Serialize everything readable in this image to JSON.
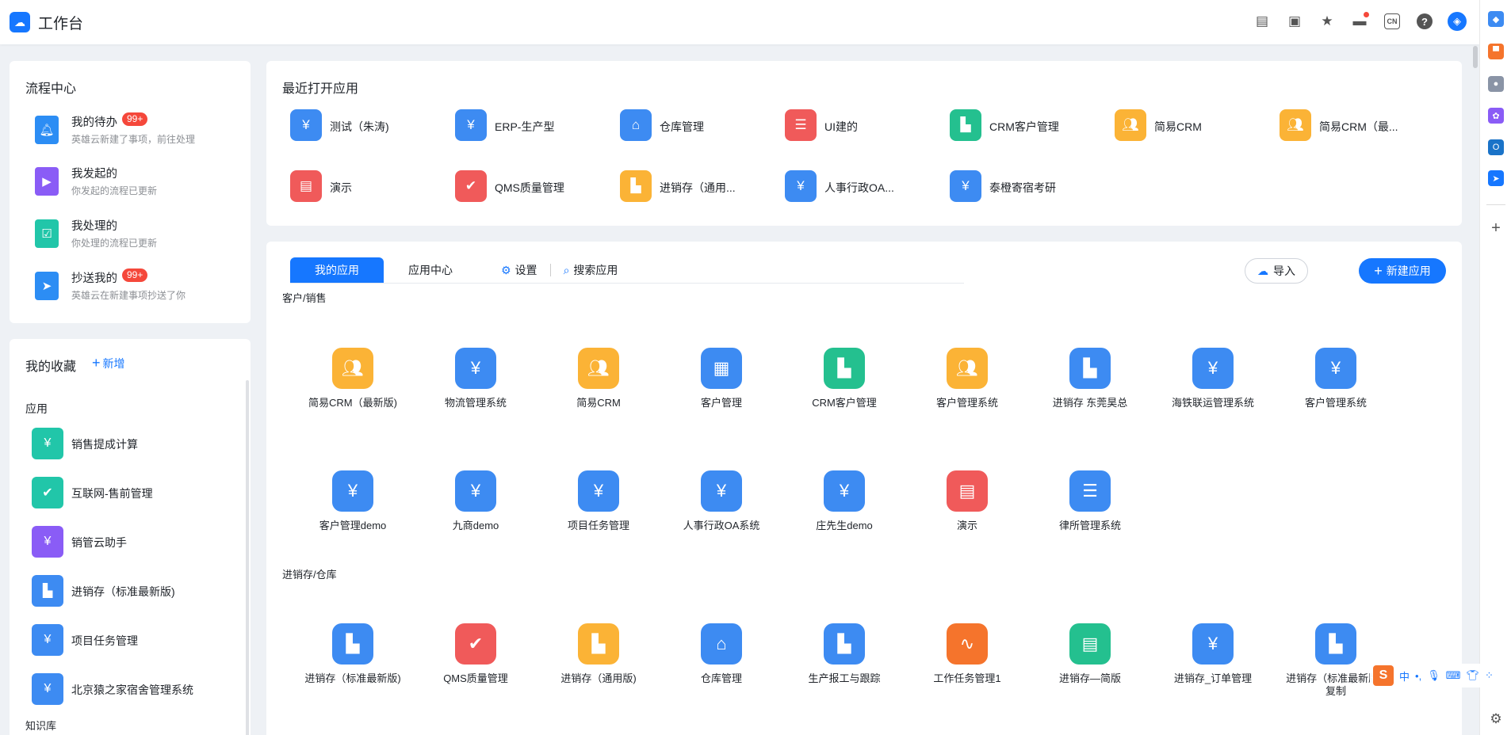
{
  "header": {
    "title": "工作台",
    "cn_label": "CN",
    "help_label": "?"
  },
  "flow_center": {
    "title": "流程中心",
    "items": [
      {
        "name": "我的待办",
        "desc": "英雄云新建了事项，前往处理",
        "badge": "99+",
        "icon": "bell-icon"
      },
      {
        "name": "我发起的",
        "desc": "你发起的流程已更新",
        "badge": "",
        "icon": "play-icon"
      },
      {
        "name": "我处理的",
        "desc": "你处理的流程已更新",
        "badge": "",
        "icon": "check-doc-icon"
      },
      {
        "name": "抄送我的",
        "desc": "英雄云在新建事项抄送了你",
        "badge": "99+",
        "icon": "send-icon"
      }
    ]
  },
  "favorites": {
    "title": "我的收藏",
    "add_label": "新增",
    "section_apps": "应用",
    "section_kb": "知识库",
    "items": [
      {
        "name": "销售提成计算",
        "icon": "doc-yen-icon"
      },
      {
        "name": "互联网-售前管理",
        "icon": "puzzle-check-icon"
      },
      {
        "name": "销管云助手",
        "icon": "hand-yen-icon"
      },
      {
        "name": "进销存（标准最新版)",
        "icon": "building-icon"
      },
      {
        "name": "项目任务管理",
        "icon": "pie-yen-icon"
      },
      {
        "name": "北京猿之家宿舍管理系统",
        "icon": "pie-yen-icon"
      }
    ]
  },
  "recent": {
    "title": "最近打开应用",
    "items": [
      {
        "name": "测试（朱涛)",
        "icon": "pie-yen-icon",
        "color": "blue"
      },
      {
        "name": "ERP-生产型",
        "icon": "pie-yen-icon",
        "color": "blue"
      },
      {
        "name": "仓库管理",
        "icon": "warehouse-icon",
        "color": "blue"
      },
      {
        "name": "UI建的",
        "icon": "list-icon",
        "color": "red"
      },
      {
        "name": "CRM客户管理",
        "icon": "building-icon",
        "color": "green"
      },
      {
        "name": "简易CRM",
        "icon": "people-icon",
        "color": "orange"
      },
      {
        "name": "简易CRM（最...",
        "icon": "people-icon",
        "color": "orange"
      },
      {
        "name": "演示",
        "icon": "doc-icon",
        "color": "red"
      },
      {
        "name": "QMS质量管理",
        "icon": "puzzle-check-icon",
        "color": "red"
      },
      {
        "name": "进销存（通用...",
        "icon": "building-icon",
        "color": "orange"
      },
      {
        "name": "人事行政OA...",
        "icon": "pie-yen-icon",
        "color": "blue"
      },
      {
        "name": "泰橙寄宿考研",
        "icon": "pie-yen-icon",
        "color": "blue"
      }
    ]
  },
  "apps": {
    "tabs": [
      "我的应用",
      "应用中心"
    ],
    "settings_label": "设置",
    "search_placeholder": "搜索应用",
    "import_label": "导入",
    "new_label": "新建应用",
    "categories": [
      {
        "label": "客户/销售",
        "apps": [
          {
            "name": "简易CRM（最新版)",
            "icon": "people-icon",
            "color": "orange"
          },
          {
            "name": "物流管理系统",
            "icon": "pie-yen-icon",
            "color": "blue"
          },
          {
            "name": "简易CRM",
            "icon": "people-icon",
            "color": "orange"
          },
          {
            "name": "客户管理",
            "icon": "office-building-icon",
            "color": "blue"
          },
          {
            "name": "CRM客户管理",
            "icon": "building-icon",
            "color": "green"
          },
          {
            "name": "客户管理系统",
            "icon": "people-icon",
            "color": "orange"
          },
          {
            "name": "进销存 东莞昊总",
            "icon": "building-icon",
            "color": "blue"
          },
          {
            "name": "海铁联运管理系统",
            "icon": "pie-yen-icon",
            "color": "blue"
          },
          {
            "name": "客户管理系统",
            "icon": "pie-yen-icon",
            "color": "blue"
          },
          {
            "name": "客户管理demo",
            "icon": "pie-yen-icon",
            "color": "blue"
          },
          {
            "name": "九商demo",
            "icon": "pie-yen-icon",
            "color": "blue"
          },
          {
            "name": "项目任务管理",
            "icon": "pie-yen-icon",
            "color": "blue"
          },
          {
            "name": "人事行政OA系统",
            "icon": "pie-yen-icon",
            "color": "blue"
          },
          {
            "name": "庄先生demo",
            "icon": "pie-yen-icon",
            "color": "blue"
          },
          {
            "name": "演示",
            "icon": "doc-icon",
            "color": "red"
          },
          {
            "name": "律所管理系统",
            "icon": "list-icon",
            "color": "blue"
          }
        ]
      },
      {
        "label": "进销存/仓库",
        "apps": [
          {
            "name": "进销存（标准最新版)",
            "icon": "building-icon",
            "color": "blue"
          },
          {
            "name": "QMS质量管理",
            "icon": "puzzle-check-icon",
            "color": "red"
          },
          {
            "name": "进销存（通用版)",
            "icon": "building-icon",
            "color": "orange"
          },
          {
            "name": "仓库管理",
            "icon": "warehouse-icon",
            "color": "blue"
          },
          {
            "name": "生产报工与跟踪",
            "icon": "building-icon",
            "color": "blue"
          },
          {
            "name": "工作任务管理1",
            "icon": "chart-doc-icon",
            "color": "deeporange"
          },
          {
            "name": "进销存—简版",
            "icon": "doc-icon",
            "color": "green"
          },
          {
            "name": "进销存_订单管理",
            "icon": "pie-yen-icon",
            "color": "blue"
          },
          {
            "name": "进销存（标准最新版)-复制",
            "icon": "building-icon",
            "color": "blue"
          }
        ]
      }
    ]
  },
  "ime": {
    "label": "中"
  }
}
